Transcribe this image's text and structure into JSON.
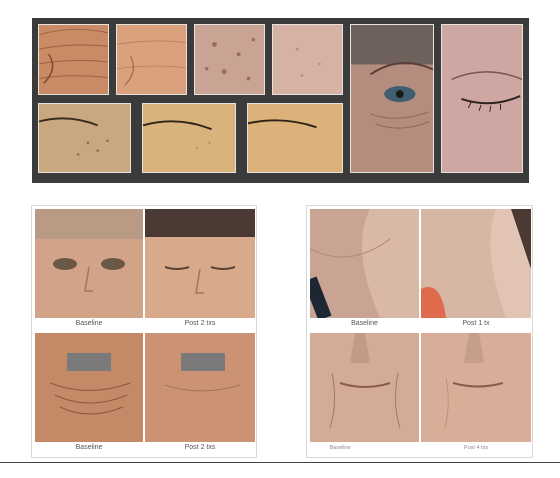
{
  "collage_left": {
    "row1": {
      "left_caption": "Baseline",
      "right_caption": "Post 2 txs"
    },
    "row2": {
      "left_caption": "Baseline",
      "right_caption": "Post 2 txs"
    }
  },
  "collage_right": {
    "row1": {
      "left_caption": "Baseline",
      "right_caption": "Post 1 tx"
    },
    "row2": {
      "left_caption": "Baseline",
      "right_caption": "Post 4 txs"
    }
  },
  "colors": {
    "panel_dark": "#3b3b3b",
    "skin_tone": "#d9a986",
    "caption_text": "#555555"
  }
}
